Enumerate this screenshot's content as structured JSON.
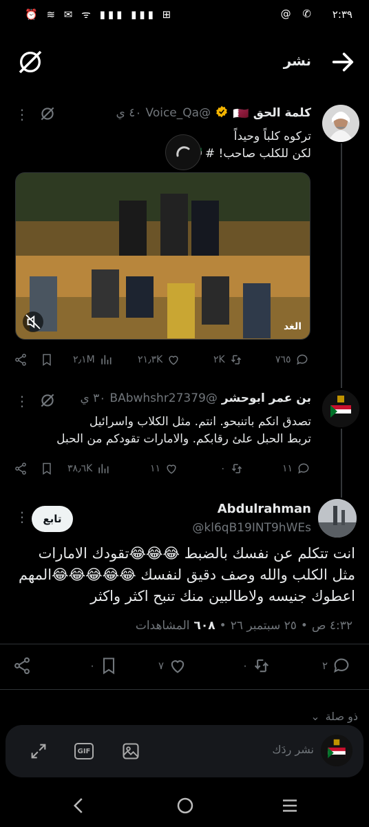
{
  "status_bar": {
    "time": "٢:٣٩",
    "right_icons": "@ ✆",
    "left_icons": "⏰ ≋ ✉ ᯤ ▮▮▮ ▮▮▮ ⊞"
  },
  "header": {
    "title": "نشر",
    "back_icon": "arrow-right-icon",
    "grok_icon": "grok-icon"
  },
  "tweet1": {
    "name": "كلمة الحق",
    "flag": "🇶🇦",
    "handle": "@Voice_Qa",
    "time": "٤٠ ي",
    "line1": "تركوه كلباً وحيداً",
    "line2": "لكن للكلب صاحب! #",
    "line2_flags": "🇮🇱🇦🇪",
    "video_watermark": "الغد",
    "actions": {
      "replies": "٧٦٥",
      "retweets": "٢K",
      "likes": "٢١٫٣K",
      "views": "٢٫١M"
    }
  },
  "tweet2": {
    "name": "بن عمر ابوحشر",
    "handle": "@BAbwhshr27379",
    "time": "٣٠ ي",
    "line1": "تصدق انكم باتنبحو. انتم. مثل الكلاب  واسرائيل",
    "line2": "تربط الحبل علئ رقابكم. والامارات تقودكم من الحبل",
    "actions": {
      "replies": "١١",
      "retweets": "٠",
      "likes": "١١",
      "views": "٣٨٫٦K"
    }
  },
  "tweet3": {
    "name": "Abdulrahman",
    "handle": "@kl6qB19INT9hWEs",
    "follow_label": "تابع",
    "text": "انت تتكلم عن نفسك بالضبط 😂😂😂تقودك الامارات مثل الكلب والله وصف دقيق لنفسك 😂😂😂😂😂المهم اعطوك جنيسه ولاطالبين منك تنبح اكثر واكثر",
    "meta": {
      "time": "٤:٣٢ ص",
      "date": "٢٥ سبتمبر ٢٦",
      "views_count": "٦٠٨",
      "views_label": "المشاهدات"
    },
    "actions": {
      "replies": "٢",
      "retweets": "٠",
      "likes": "٧",
      "bookmarks": "٠"
    }
  },
  "reply_composer": {
    "placeholder": "نشر ردَك",
    "relevance_label": "ذو صلة",
    "gif_label": "GIF"
  },
  "colors": {
    "background": "#000000",
    "text": "#e7e9ea",
    "muted": "#71767b",
    "divider": "#2f3336",
    "accent": "#1d9bf0"
  }
}
